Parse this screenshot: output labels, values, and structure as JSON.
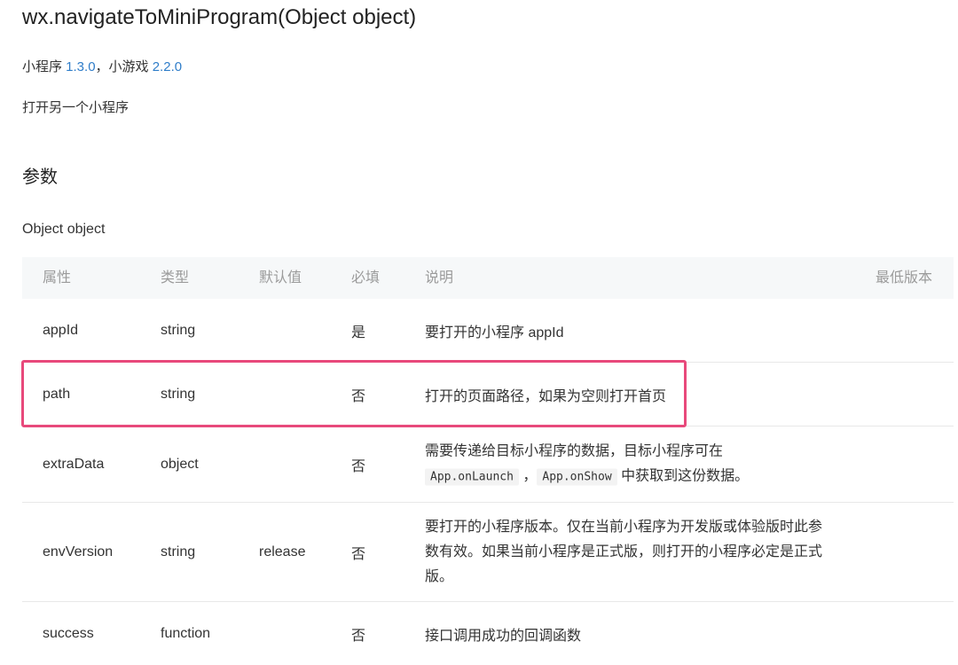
{
  "api": {
    "title": "wx.navigateToMiniProgram(Object object)",
    "support_prefix_1": "小程序 ",
    "support_version_1": "1.3.0",
    "support_sep": "，小游戏 ",
    "support_version_2": "2.2.0",
    "description": "打开另一个小程序"
  },
  "params": {
    "section_title": "参数",
    "object_name": "Object object",
    "headers": {
      "attr": "属性",
      "type": "类型",
      "default": "默认值",
      "required": "必填",
      "description": "说明",
      "min_version": "最低版本"
    },
    "rows": [
      {
        "attr": "appId",
        "type": "string",
        "default": "",
        "required": "是",
        "description": "要打开的小程序 appId"
      },
      {
        "attr": "path",
        "type": "string",
        "default": "",
        "required": "否",
        "description": "打开的页面路径，如果为空则打开首页"
      },
      {
        "attr": "extraData",
        "type": "object",
        "default": "",
        "required": "否",
        "description_line1": "需要传递给目标小程序的数据，目标小程序可在",
        "code1": "App.onLaunch",
        "sep": " ，",
        "code2": "App.onShow",
        "description_tail": " 中获取到这份数据。"
      },
      {
        "attr": "envVersion",
        "type": "string",
        "default": "release",
        "required": "否",
        "description": "要打开的小程序版本。仅在当前小程序为开发版或体验版时此参数有效。如果当前小程序是正式版，则打开的小程序必定是正式版。"
      },
      {
        "attr": "success",
        "type": "function",
        "default": "",
        "required": "否",
        "description": "接口调用成功的回调函数"
      }
    ]
  },
  "colors": {
    "link": "#2f7dc9",
    "highlight": "#e8497b",
    "header_bg": "#f6f8f9"
  }
}
